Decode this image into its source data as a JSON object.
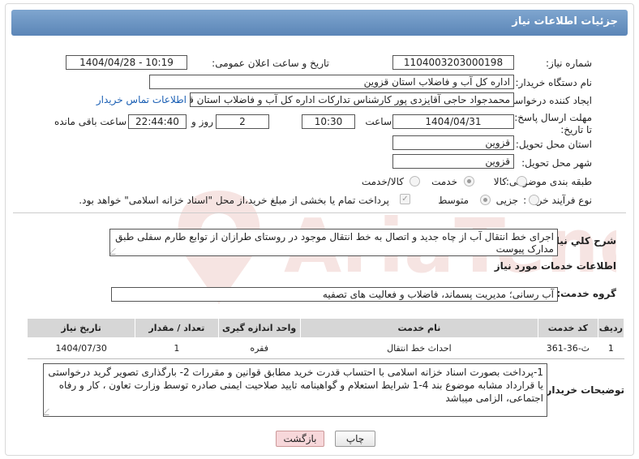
{
  "title": "جزئیات اطلاعات نیاز",
  "labels": {
    "need_number": "شماره نیاز:",
    "announce_date": "تاریخ و ساعت اعلان عمومی:",
    "buyer_org": "نام دستگاه خریدار:",
    "requester": "ایجاد کننده درخواست:",
    "contact_link": "اطلاعات تماس خریدار",
    "deadline": "مهلت ارسال پاسخ: تا تاریخ:",
    "hour": "ساعت",
    "day": "روز و",
    "remaining": "ساعت باقی مانده",
    "province": "استان محل تحویل:",
    "city": "شهر محل تحویل:",
    "category": "طبقه بندی موضوعی:",
    "process": "نوع فرآیند خرید :",
    "summary": "شرح کلي نياز:",
    "services_header": "اطلاعات خدمات مورد نیاز",
    "service_group": "گروه خدمت:",
    "buyer_notes": "توضیحات خریدار:"
  },
  "values": {
    "need_number": "1104003203000198",
    "announce_datetime": "1404/04/28 - 10:19",
    "buyer_org": "اداره کل آب و فاضلاب استان قزوین",
    "requester": "محمدجواد حاجی آقایزدی پور کارشناس تدارکات اداره کل آب و فاضلاب استان قزوین",
    "deadline_date": "1404/04/31",
    "deadline_time": "10:30",
    "days_left": "2",
    "time_left": "22:44:40",
    "province": "قزوین",
    "city": "قزوین",
    "summary": "اجرای خط انتقال آب از چاه جدید و اتصال به خط انتقال موجود در روستای طرازان از توابع طارم سفلی طبق مدارک پیوست",
    "service_group": "آب رسانی؛ مدیریت پسماند، فاضلاب و فعالیت های تصفیه",
    "buyer_notes": "1-پرداخت بصورت اسناد خزانه اسلامی با احتساب قدرت خرید مطابق قوانین و مقررات 2- بارگذاری تصویر گرید درخواستی یا قرارداد مشابه موضوع بند 4-1 شرایط استعلام و گواهینامه تایید صلاحیت ایمنی صادره توسط وزارت تعاون ، کار و رفاه اجتماعی، الزامی میباشد"
  },
  "category_options": [
    {
      "label": "کالا",
      "selected": false
    },
    {
      "label": "خدمت",
      "selected": true
    },
    {
      "label": "کالا/خدمت",
      "selected": false
    }
  ],
  "process_options": [
    {
      "label": "جزیی",
      "selected": false
    },
    {
      "label": "متوسط",
      "selected": true
    }
  ],
  "treasury_note": "پرداخت تمام یا بخشی از مبلغ خرید،از محل \"اسناد خزانه اسلامی\" خواهد بود.",
  "table": {
    "headers": [
      "ردیف",
      "کد خدمت",
      "نام خدمت",
      "واحد اندازه گیری",
      "تعداد / مقدار",
      "تاریخ نیاز"
    ],
    "rows": [
      [
        "1",
        "ث-36-361",
        "احداث خط انتقال",
        "فقره",
        "1",
        "1404/07/30"
      ]
    ]
  },
  "buttons": {
    "print": "چاپ",
    "back": "بازگشت"
  },
  "colors": {
    "title_bar": "#6b93c2",
    "link": "#1a5fb4",
    "back_button": "#f7d7da"
  }
}
